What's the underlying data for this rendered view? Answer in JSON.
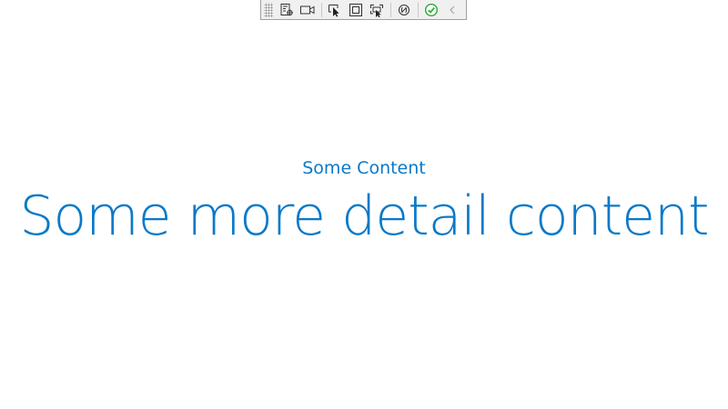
{
  "toolbar": {
    "buttons": [
      {
        "icon": "live-visual-tree-icon"
      },
      {
        "icon": "video-camera-icon"
      },
      {
        "icon": "select-element-icon"
      },
      {
        "icon": "display-layout-adorners-icon"
      },
      {
        "icon": "track-focus-icon"
      },
      {
        "icon": "binding-failures-icon"
      },
      {
        "icon": "hot-reload-ok-icon"
      },
      {
        "icon": "collapse-toolbar-icon"
      }
    ]
  },
  "main": {
    "subtitle": "Some Content",
    "detail": "Some more detail content"
  },
  "colors": {
    "accent": "#0a79c8",
    "toolbar_bg": "#f0f0f0",
    "ok_green": "#2aa832"
  }
}
